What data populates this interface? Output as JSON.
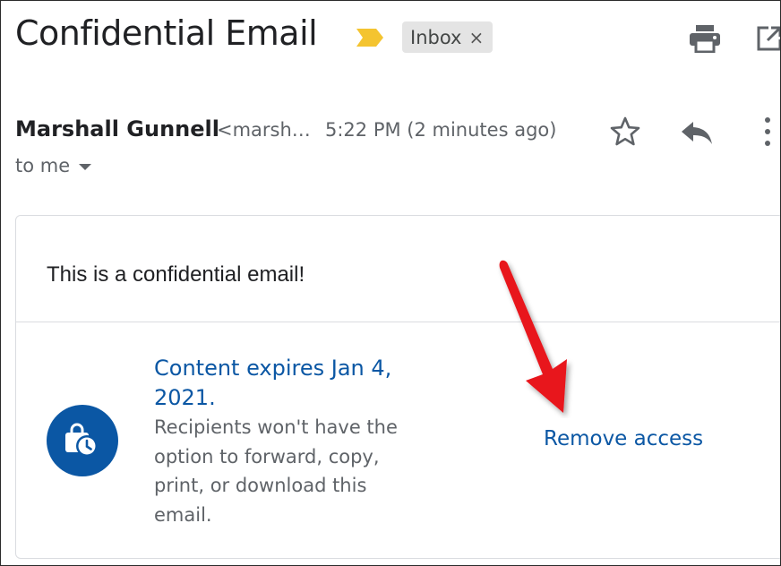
{
  "email": {
    "subject": "Confidential Email",
    "label_chip": {
      "label": "Inbox",
      "close_glyph": "×"
    },
    "sender": {
      "name": "Marshall Gunnell",
      "email_truncated": "<marsh…"
    },
    "timestamp": "5:22 PM (2 minutes ago)",
    "recipient": "to me",
    "body": "This is a confidential email!",
    "confidential": {
      "expiry_title": "Content expires Jan 4, 2021.",
      "description": "Recipients won't have the option to forward, copy, print, or download this email.",
      "remove_access": "Remove access"
    }
  },
  "icons": {
    "important_marker": "important-marker-icon",
    "print": "print-icon",
    "open_new_window": "open-in-new-window-icon",
    "star": "star-icon",
    "reply": "reply-icon",
    "more": "more-vert-icon",
    "recipient_dropdown": "chevron-down-icon",
    "confidential": "confidential-mode-lock-clock-icon"
  },
  "colors": {
    "important_marker": "#f4c430",
    "link_blue": "#0b57a4",
    "annotation_arrow": "#e8131b",
    "text_primary": "#202124",
    "text_secondary": "#5f6368",
    "chip_bg": "#e4e4e4"
  }
}
